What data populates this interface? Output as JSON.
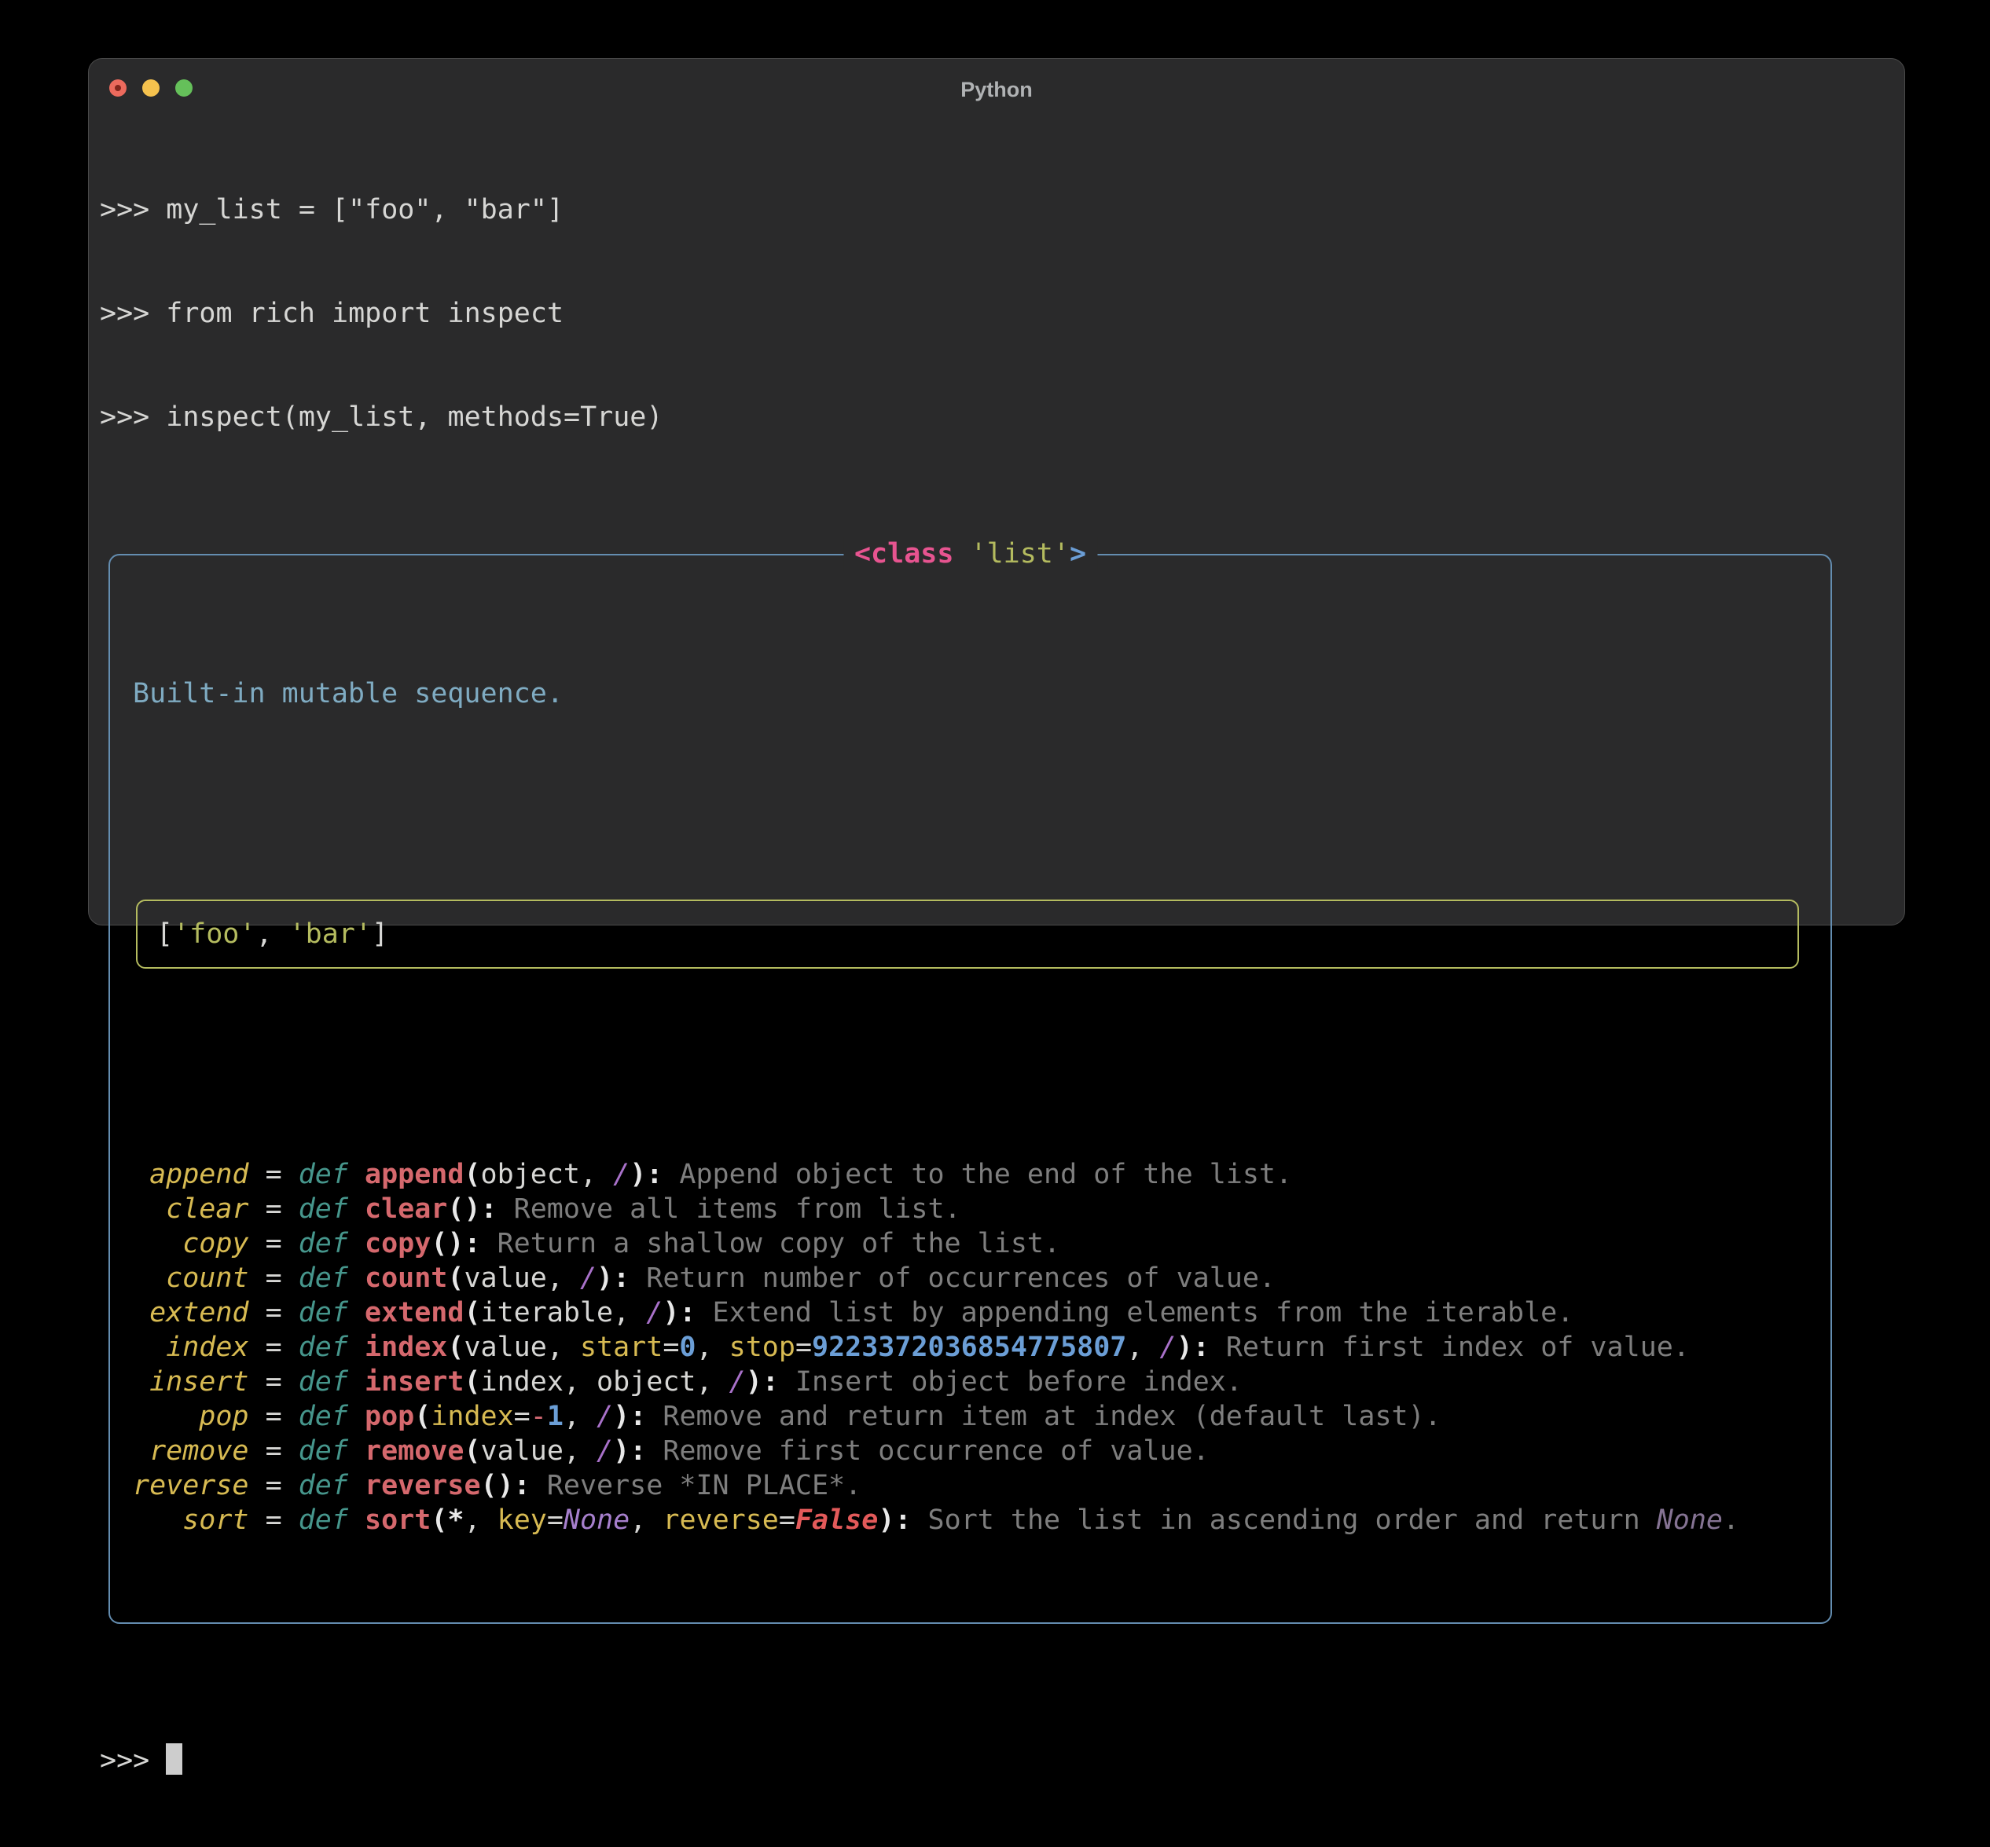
{
  "window": {
    "title": "Python",
    "traffic_lights": {
      "close": "close-with-unsaved-dot",
      "minimize": "minimize",
      "zoom": "zoom"
    }
  },
  "colors": {
    "desktop_bg": "#000000",
    "window_bg": "#2a2a2b",
    "panel_border": "#648db0",
    "value_box_border": "#b4bb5f",
    "string_olive": "#b4bb5f",
    "attr_yellow": "#d7ba52",
    "def_teal": "#46968c",
    "fn_red": "#d5686d",
    "number_blue": "#6b9ed6",
    "purple": "#a871c9",
    "class_pink": "#e75490",
    "docstring_blue": "#7fabc2",
    "desc_gray": "#7e7e7e",
    "cursor": "#cdcdcd",
    "traffic_red": "#ec6a5d",
    "traffic_yellow": "#f5c24e",
    "traffic_green": "#65c05a"
  },
  "prompt_lines": [
    ">>> my_list = [\"foo\", \"bar\"]",
    ">>> from rich import inspect",
    ">>> inspect(my_list, methods=True)"
  ],
  "panel": {
    "title_text": "<class 'list'>",
    "title_segments": [
      [
        "<class",
        "tagpink"
      ],
      [
        " ",
        "plain"
      ],
      [
        "'list'",
        "str"
      ],
      [
        ">",
        "tagblue"
      ]
    ],
    "docstring": "Built-in mutable sequence.",
    "value_text": "['foo', 'bar']",
    "value_segments": [
      [
        "[",
        "plain"
      ],
      [
        "'foo'",
        "str"
      ],
      [
        ", ",
        "plain"
      ],
      [
        "'bar'",
        "str"
      ],
      [
        "]",
        "plain"
      ]
    ],
    "methods": [
      {
        "name": "append",
        "sig": [
          [
            "def ",
            "def"
          ],
          [
            "append",
            "fn"
          ],
          [
            "(",
            "paren"
          ],
          [
            "object, ",
            "plain"
          ],
          [
            "/",
            "slash"
          ],
          [
            "):",
            "paren"
          ],
          [
            " Append object to the end of the list.",
            "desc"
          ]
        ]
      },
      {
        "name": "clear",
        "sig": [
          [
            "def ",
            "def"
          ],
          [
            "clear",
            "fn"
          ],
          [
            "():",
            "paren"
          ],
          [
            " Remove all items from list.",
            "desc"
          ]
        ]
      },
      {
        "name": "copy",
        "sig": [
          [
            "def ",
            "def"
          ],
          [
            "copy",
            "fn"
          ],
          [
            "():",
            "paren"
          ],
          [
            " Return a shallow copy of the list.",
            "desc"
          ]
        ]
      },
      {
        "name": "count",
        "sig": [
          [
            "def ",
            "def"
          ],
          [
            "count",
            "fn"
          ],
          [
            "(",
            "paren"
          ],
          [
            "value, ",
            "plain"
          ],
          [
            "/",
            "slash"
          ],
          [
            "):",
            "paren"
          ],
          [
            " Return number of occurrences of value.",
            "desc"
          ]
        ]
      },
      {
        "name": "extend",
        "sig": [
          [
            "def ",
            "def"
          ],
          [
            "extend",
            "fn"
          ],
          [
            "(",
            "paren"
          ],
          [
            "iterable, ",
            "plain"
          ],
          [
            "/",
            "slash"
          ],
          [
            "):",
            "paren"
          ],
          [
            " Extend list by appending elements from the iterable.",
            "desc"
          ]
        ]
      },
      {
        "name": "index",
        "sig": [
          [
            "def ",
            "def"
          ],
          [
            "index",
            "fn"
          ],
          [
            "(",
            "paren"
          ],
          [
            "value, ",
            "plain"
          ],
          [
            "start",
            "kw"
          ],
          [
            "=",
            "plain"
          ],
          [
            "0",
            "num"
          ],
          [
            ", ",
            "plain"
          ],
          [
            "stop",
            "kw"
          ],
          [
            "=",
            "plain"
          ],
          [
            "9223372036854775807",
            "num"
          ],
          [
            ", ",
            "plain"
          ],
          [
            "/",
            "slash"
          ],
          [
            "):",
            "paren"
          ],
          [
            " Return first index of value.",
            "desc"
          ]
        ]
      },
      {
        "name": "insert",
        "sig": [
          [
            "def ",
            "def"
          ],
          [
            "insert",
            "fn"
          ],
          [
            "(",
            "paren"
          ],
          [
            "index, object, ",
            "plain"
          ],
          [
            "/",
            "slash"
          ],
          [
            "):",
            "paren"
          ],
          [
            " Insert object before index.",
            "desc"
          ]
        ]
      },
      {
        "name": "pop",
        "sig": [
          [
            "def ",
            "def"
          ],
          [
            "pop",
            "fn"
          ],
          [
            "(",
            "paren"
          ],
          [
            "index",
            "kw"
          ],
          [
            "=",
            "plain"
          ],
          [
            "-",
            "minus"
          ],
          [
            "1",
            "num"
          ],
          [
            ", ",
            "plain"
          ],
          [
            "/",
            "slash"
          ],
          [
            "):",
            "paren"
          ],
          [
            " Remove and return item at index (default last).",
            "desc"
          ]
        ]
      },
      {
        "name": "remove",
        "sig": [
          [
            "def ",
            "def"
          ],
          [
            "remove",
            "fn"
          ],
          [
            "(",
            "paren"
          ],
          [
            "value, ",
            "plain"
          ],
          [
            "/",
            "slash"
          ],
          [
            "):",
            "paren"
          ],
          [
            " Remove first occurrence of value.",
            "desc"
          ]
        ]
      },
      {
        "name": "reverse",
        "sig": [
          [
            "def ",
            "def"
          ],
          [
            "reverse",
            "fn"
          ],
          [
            "():",
            "paren"
          ],
          [
            " Reverse *IN PLACE*.",
            "desc"
          ]
        ]
      },
      {
        "name": "sort",
        "sig": [
          [
            "def ",
            "def"
          ],
          [
            "sort",
            "fn"
          ],
          [
            "(",
            "paren"
          ],
          [
            "*",
            "star"
          ],
          [
            ", ",
            "plain"
          ],
          [
            "key",
            "kw"
          ],
          [
            "=",
            "plain"
          ],
          [
            "None",
            "none"
          ],
          [
            ", ",
            "plain"
          ],
          [
            "reverse",
            "kw"
          ],
          [
            "=",
            "plain"
          ],
          [
            "False",
            "false"
          ],
          [
            "):",
            "paren"
          ],
          [
            " Sort the list in ascending order and return ",
            "desc"
          ],
          [
            "None",
            "nonedim"
          ],
          [
            ".",
            "desc"
          ]
        ]
      }
    ]
  },
  "bottom_prompt": ">>> "
}
